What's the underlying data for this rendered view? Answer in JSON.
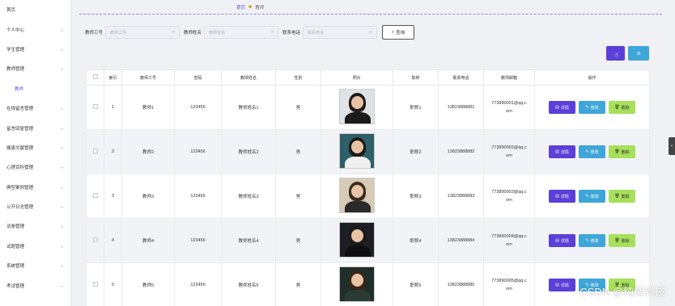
{
  "sidebar": {
    "items": [
      {
        "label": "首页",
        "chevron": false
      },
      {
        "label": "个人中心",
        "chevron": true
      },
      {
        "label": "学生管理",
        "chevron": true
      },
      {
        "label": "教师管理",
        "chevron": true
      },
      {
        "label": "教师",
        "chevron": false,
        "sub": true
      },
      {
        "label": "在线留言管理",
        "chevron": true
      },
      {
        "label": "留言回复管理",
        "chevron": true
      },
      {
        "label": "健康文献管理",
        "chevron": true
      },
      {
        "label": "心理百科管理",
        "chevron": true
      },
      {
        "label": "典型案例管理",
        "chevron": true
      },
      {
        "label": "公开日志管理",
        "chevron": true
      },
      {
        "label": "试卷管理",
        "chevron": true
      },
      {
        "label": "试题管理",
        "chevron": true
      },
      {
        "label": "系统管理",
        "chevron": true
      },
      {
        "label": "考试管理",
        "chevron": true
      }
    ]
  },
  "breadcrumb": {
    "home": "首页",
    "current": "教师"
  },
  "search": {
    "teacher_no_label": "教师工号",
    "teacher_no_placeholder": "教师工号",
    "teacher_name_label": "教师姓名",
    "teacher_name_placeholder": "教师姓名",
    "phone_label": "联系电话",
    "phone_placeholder": "联系电话",
    "query_label": "查询"
  },
  "toolbar": {
    "delete_label": "⊘"
  },
  "table": {
    "headers": [
      "",
      "索引",
      "教师工号",
      "密码",
      "教师姓名",
      "性别",
      "照片",
      "职称",
      "联系电话",
      "教师邮箱",
      "操作"
    ],
    "rows": [
      {
        "index": "1",
        "no": "教师1",
        "password": "123456",
        "name": "教师姓名1",
        "gender": "男",
        "title": "职称1",
        "phone": "13823888881",
        "email1": "773890001@qq.c",
        "email2": "om"
      },
      {
        "index": "2",
        "no": "教师2",
        "password": "123456",
        "name": "教师姓名2",
        "gender": "男",
        "title": "职称2",
        "phone": "13823888882",
        "email1": "773890002@qq.c",
        "email2": "om"
      },
      {
        "index": "3",
        "no": "教师3",
        "password": "123456",
        "name": "教师姓名3",
        "gender": "男",
        "title": "职称3",
        "phone": "13823888883",
        "email1": "773890003@qq.c",
        "email2": "om"
      },
      {
        "index": "4",
        "no": "教师4",
        "password": "123456",
        "name": "教师姓名4",
        "gender": "男",
        "title": "职称4",
        "phone": "13823888884",
        "email1": "773890004@qq.c",
        "email2": "om"
      },
      {
        "index": "5",
        "no": "教师5",
        "password": "123456",
        "name": "教师姓名5",
        "gender": "男",
        "title": "职称5",
        "phone": "13823888885",
        "email1": "773890005@qq.c",
        "email2": "om"
      }
    ],
    "ops": {
      "detail": "详情",
      "edit": "修改",
      "remove": "删除"
    }
  },
  "watermark": "CSDN @纯情科技",
  "colors": {
    "primary": "#5b3fd9",
    "info": "#3fa6d9",
    "success": "#a7e05a"
  }
}
